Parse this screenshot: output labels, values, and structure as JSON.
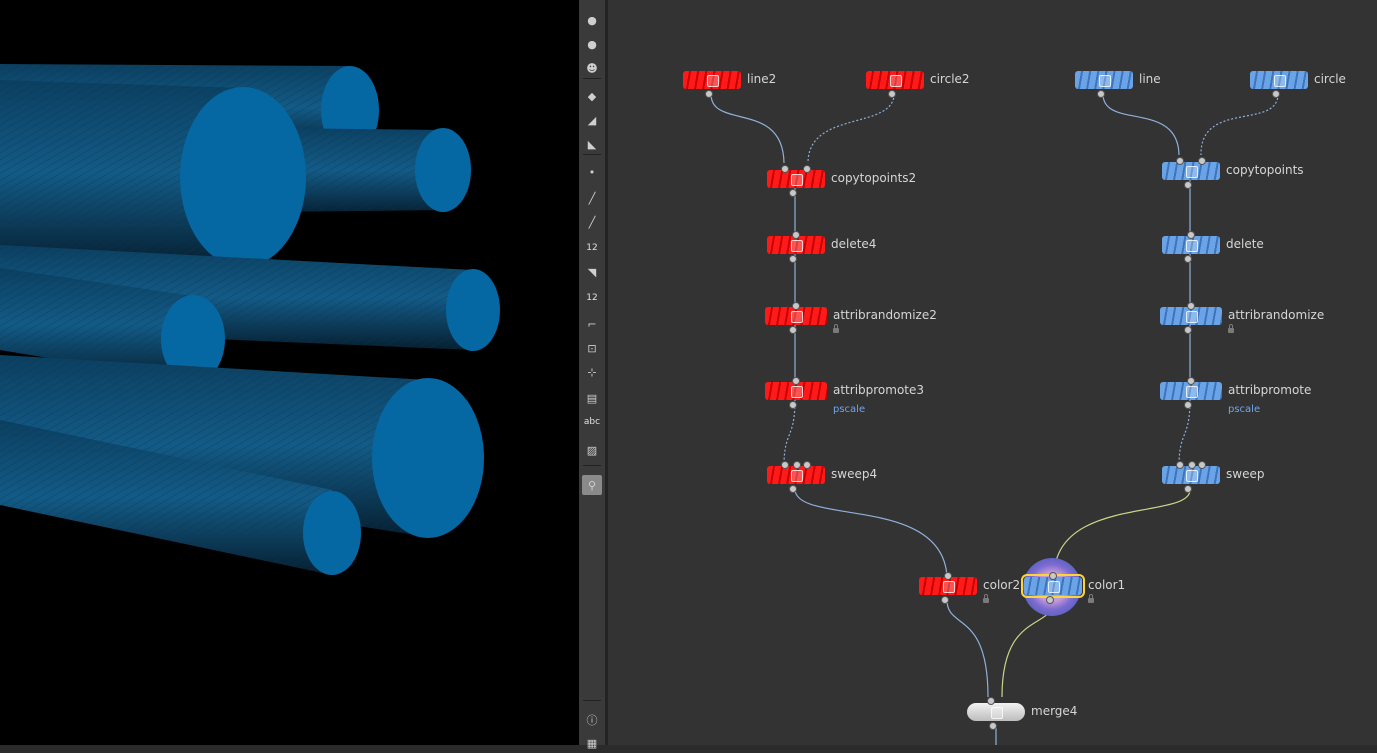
{
  "toolbar": {
    "items": [
      {
        "name": "light-icon",
        "glyph": "●"
      },
      {
        "name": "spot-light-icon",
        "glyph": "●"
      },
      {
        "name": "skull-light-icon",
        "glyph": "☻"
      },
      {
        "name": "geometry-icon",
        "glyph": "◆"
      },
      {
        "name": "camera-icon",
        "glyph": "◢"
      },
      {
        "name": "camera-icon-2",
        "glyph": "◣"
      },
      {
        "name": "point-icon",
        "glyph": "•"
      },
      {
        "name": "edge-icon",
        "glyph": "╱"
      },
      {
        "name": "brush-icon",
        "glyph": "╱"
      },
      {
        "name": "point-number-icon",
        "label": "12"
      },
      {
        "name": "primitive-icon",
        "glyph": "◥"
      },
      {
        "name": "primitive-number-icon",
        "label": "12"
      },
      {
        "name": "frame-icon",
        "glyph": "⌐"
      },
      {
        "name": "bounding-box-icon",
        "glyph": "⊡"
      },
      {
        "name": "normal-icon",
        "glyph": "⊹"
      },
      {
        "name": "shading-icon",
        "glyph": "▤"
      },
      {
        "name": "text-label-icon",
        "label": "abc"
      },
      {
        "name": "image-icon",
        "glyph": "▨"
      },
      {
        "name": "pin-icon",
        "glyph": "⚲"
      },
      {
        "name": "info-icon",
        "glyph": "ⓘ"
      },
      {
        "name": "layout-icon",
        "glyph": "▦"
      }
    ]
  },
  "network": {
    "nodes": [
      {
        "id": "line2",
        "label": "line2",
        "color": "red",
        "icon": "line-sop-icon"
      },
      {
        "id": "circle2",
        "label": "circle2",
        "color": "red",
        "icon": "circle-sop-icon"
      },
      {
        "id": "copytopoints2",
        "label": "copytopoints2",
        "color": "red",
        "icon": "copytopoints-sop-icon"
      },
      {
        "id": "delete4",
        "label": "delete4",
        "color": "red",
        "icon": "delete-sop-icon"
      },
      {
        "id": "attribrandomize2",
        "label": "attribrandomize2",
        "color": "red",
        "icon": "attribrandomize-sop-icon",
        "locked": true
      },
      {
        "id": "attribpromote3",
        "label": "attribpromote3",
        "sublabel": "pscale",
        "color": "red",
        "icon": "attribpromote-sop-icon"
      },
      {
        "id": "sweep4",
        "label": "sweep4",
        "color": "red",
        "icon": "sweep-sop-icon"
      },
      {
        "id": "line",
        "label": "line",
        "color": "blue",
        "icon": "line-sop-icon"
      },
      {
        "id": "circle",
        "label": "circle",
        "color": "blue",
        "icon": "circle-sop-icon"
      },
      {
        "id": "copytopoints",
        "label": "copytopoints",
        "color": "blue",
        "icon": "copytopoints-sop-icon"
      },
      {
        "id": "delete",
        "label": "delete",
        "color": "blue",
        "icon": "delete-sop-icon"
      },
      {
        "id": "attribrandomize",
        "label": "attribrandomize",
        "color": "blue",
        "icon": "attribrandomize-sop-icon",
        "locked": true
      },
      {
        "id": "attribpromote",
        "label": "attribpromote",
        "sublabel": "pscale",
        "color": "blue",
        "icon": "attribpromote-sop-icon"
      },
      {
        "id": "sweep",
        "label": "sweep",
        "color": "blue",
        "icon": "sweep-sop-icon"
      },
      {
        "id": "color2",
        "label": "color2",
        "color": "red",
        "icon": "color-sop-icon",
        "locked": true
      },
      {
        "id": "color1",
        "label": "color1",
        "color": "blue",
        "icon": "color-sop-icon",
        "locked": true,
        "selected": true
      },
      {
        "id": "merge4",
        "label": "merge4",
        "color": "white",
        "icon": "merge-sop-icon"
      }
    ],
    "colors": {
      "red": "#ff1a1a",
      "blue": "#6aa3e6",
      "wire": "#8fb0d8",
      "selected_wire": "#c9d68a",
      "selection": "#ffd43a"
    }
  }
}
